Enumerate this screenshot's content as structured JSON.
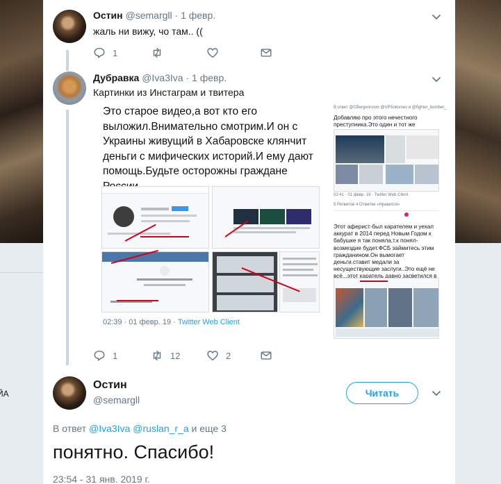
{
  "tweets": [
    {
      "name": "Остин",
      "handle": "@semargll",
      "dot": "·",
      "time": "1 февр.",
      "text": "жаль ни вижу, чо там.. ((",
      "replies": "1",
      "retweets": "",
      "likes": ""
    },
    {
      "name": "Дубравка",
      "handle": "@Iva3Iva",
      "dot": "·",
      "time": "1 февр.",
      "text": "Картинки из Инстаграм и твитера",
      "replies": "1",
      "retweets": "12",
      "likes": "2"
    }
  ],
  "media": {
    "text": "Это старое видео,а вот кто его выложил.Внимательно смотрим.И он с Украины живущий в Хабаровске клянчит деньги с мифических историй.И ему дают помощь.Будьте осторожны граждане России.",
    "caption_time": "02:39 · 01 февр. 19 ·",
    "caption_client": "Twitter Web Client",
    "right_header": "В ответ @CBergenroom @VPSolovnev и @fighter_bomber_",
    "right_text_1": "Добавляю про этого нечестного преступника.Это один и тот же человек.",
    "right_client": "02:41 · 01 февр. 19 · Twitter Web Client",
    "right_stats": "5 Ретвитов  4 Отметки «Нравится»",
    "right_text_2": "Этот аферист-был карателем и уехал аккурат в 2014 перед Новым Годом к бабушке я так поняла,т.к понял-возмездие будет.ФСБ займитесь этим гражданином.Он вымогает деньги.ставит медали за несуществующие заслуги..Это ещё не всё...этот каратель давно засветился в сетях с Хабаровска.."
  },
  "focused": {
    "name": "Остин",
    "handle": "@semargll",
    "follow_label": "Читать",
    "reply_prefix": "В ответ",
    "mention_1": "@Iva3Iva",
    "mention_2": "@ruslan_r_a",
    "reply_suffix": "и еще 3",
    "text": "понятно. Спасибо!",
    "timestamp": "23:54 - 31 янв. 2019 г."
  },
  "background": {
    "cut_text": "ЙА"
  },
  "colors": {
    "accent": "#1da1f2",
    "muted": "#657786",
    "line": "#ccd6dd",
    "like_red": "#e0245e"
  },
  "icons": [
    "reply-icon",
    "retweet-icon",
    "like-icon",
    "message-icon",
    "chevron-down-icon"
  ]
}
